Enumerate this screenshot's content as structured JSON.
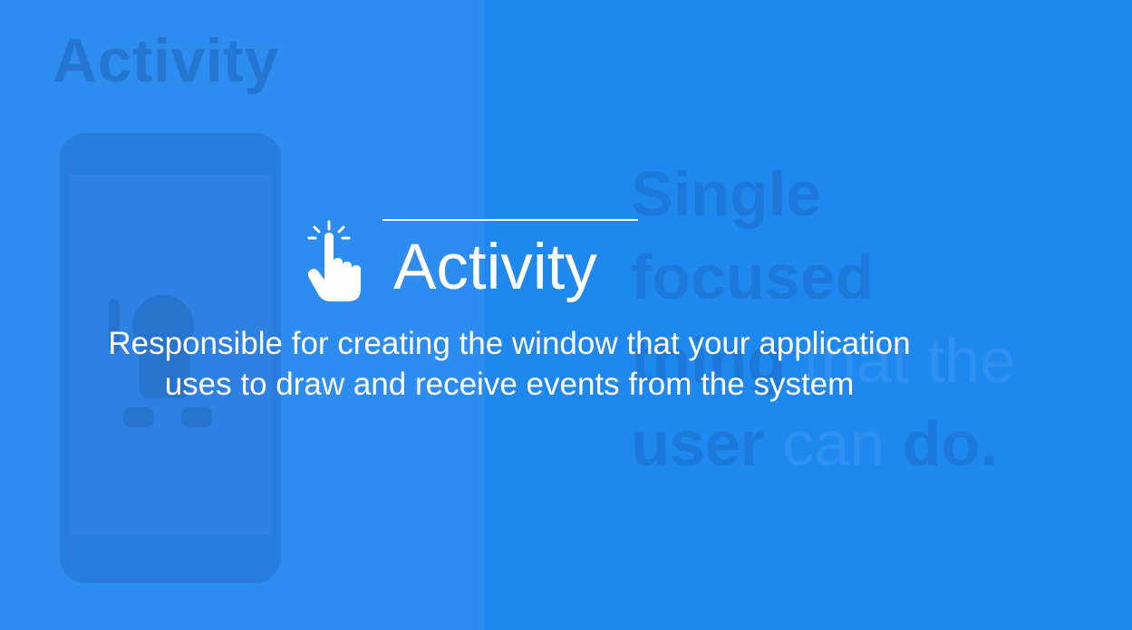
{
  "background": {
    "heading": "Activity",
    "tagline": {
      "line1": "Single",
      "line2": "focused",
      "line3_bold": "thing",
      "line3_light": " that the",
      "line4_bold": "user",
      "line4_light": " can ",
      "line4_end": "do."
    }
  },
  "overlay": {
    "icon": "tap-finger-icon",
    "title": "Activity",
    "description_line1": "Responsible for creating the window that your application",
    "description_line2": "uses to draw and receive events from the system"
  },
  "colors": {
    "background_left": "#2d8cf0",
    "background_right": "#1f88ef",
    "text": "#ffffff"
  }
}
